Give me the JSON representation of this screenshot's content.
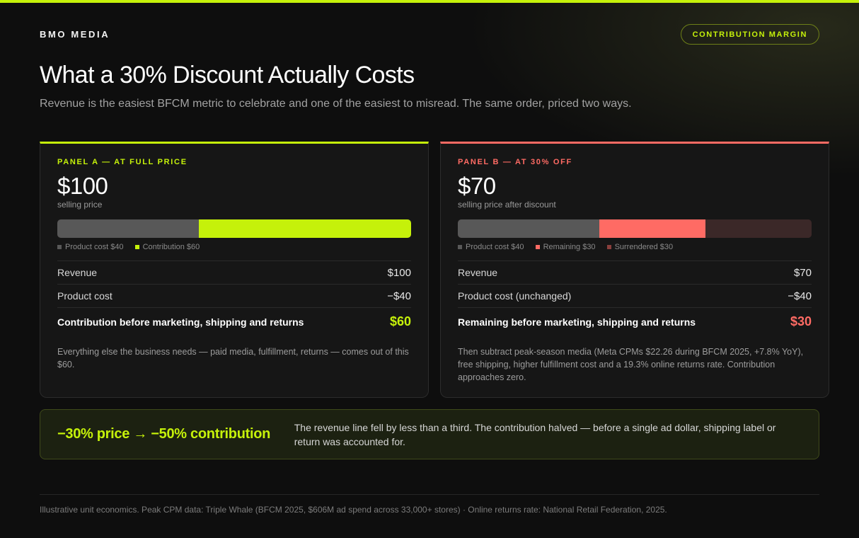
{
  "header": {
    "brand": "BMO MEDIA",
    "badge": "CONTRIBUTION MARGIN",
    "title": "What a 30% Discount Actually Costs",
    "subtitle": "Revenue is the easiest BFCM metric to celebrate and one of the easiest to misread. The same order, priced two ways."
  },
  "panel_a": {
    "tag": "PANEL A — AT FULL PRICE",
    "price": "$100",
    "price_label": "selling price",
    "bar": {
      "product_cost": 40,
      "contribution": 60,
      "total": 100
    },
    "legend": [
      "Product cost $40",
      "Contribution $60"
    ],
    "rows": [
      {
        "label": "Revenue",
        "value": "$100"
      },
      {
        "label": "Product cost",
        "value": "−$40"
      }
    ],
    "total": {
      "label": "Contribution before marketing, shipping and returns",
      "value": "$60"
    },
    "note": "Everything else the business needs — paid media, fulfillment, returns — comes out of this $60."
  },
  "panel_b": {
    "tag": "PANEL B — AT 30% OFF",
    "price": "$70",
    "price_label": "selling price after discount",
    "bar": {
      "product_cost": 40,
      "remaining": 30,
      "surrendered": 30,
      "total": 100
    },
    "legend": [
      "Product cost $40",
      "Remaining $30",
      "Surrendered $30"
    ],
    "rows": [
      {
        "label": "Revenue",
        "value": "$70"
      },
      {
        "label": "Product cost (unchanged)",
        "value": "−$40"
      }
    ],
    "total": {
      "label": "Remaining before marketing, shipping and returns",
      "value": "$30"
    },
    "note": "Then subtract peak-season media (Meta CPMs $22.26 during BFCM 2025, +7.8% YoY), free shipping, higher fulfillment cost and a 19.3% online returns rate. Contribution approaches zero."
  },
  "callout": {
    "headline": "−30% price → −50% contribution",
    "text": "The revenue line fell by less than a third. The contribution halved — before a single ad dollar, shipping label or return was accounted for."
  },
  "footer": {
    "note": "Illustrative unit economics. Peak CPM data: Triple Whale (BFCM 2025, $606M ad spend across 33,000+ stores) · Online returns rate: National Retail Federation, 2025."
  },
  "colors": {
    "accent": "#c5f10a",
    "negative": "#ff6b64",
    "cost": "#585858",
    "surrendered": "#3b2828"
  }
}
